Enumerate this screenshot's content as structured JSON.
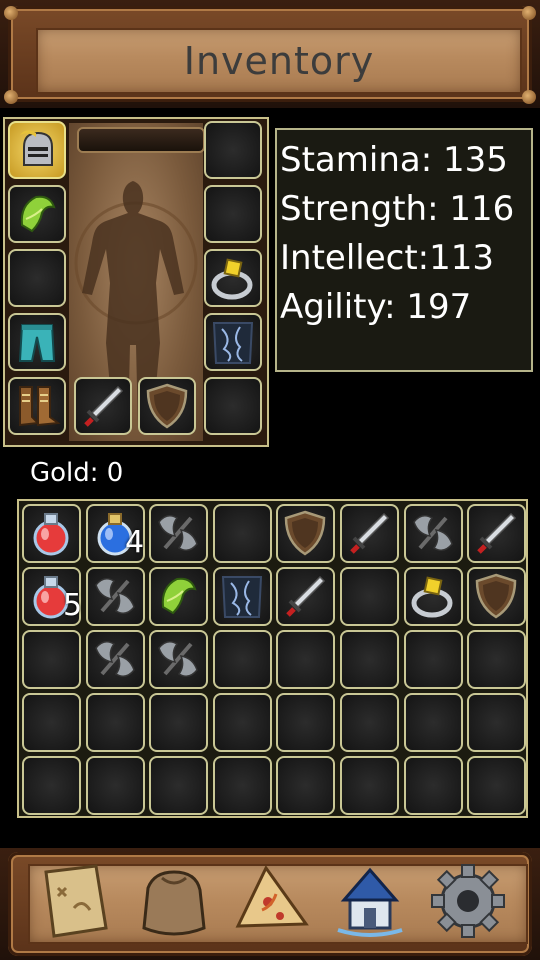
{
  "header": {
    "title": "Inventory"
  },
  "equipment": {
    "slots": [
      {
        "icon": "helmet-icon",
        "item": true
      },
      {
        "icon": "",
        "item": false
      },
      {
        "icon": "shoulder-pad-icon",
        "item": true
      },
      {
        "icon": "",
        "item": false
      },
      {
        "icon": "",
        "item": false
      },
      {
        "icon": "ring-icon",
        "item": true
      },
      {
        "icon": "pants-icon",
        "item": true
      },
      {
        "icon": "chest-armor-icon",
        "item": true
      },
      {
        "icon": "boots-icon",
        "item": true
      },
      {
        "icon": "sword-icon",
        "item": true
      },
      {
        "icon": "shield-icon",
        "item": true
      },
      {
        "icon": "",
        "item": false
      }
    ]
  },
  "stats": {
    "stamina": "Stamina: 135",
    "strength": "Strength: 116",
    "intellect": "Intellect:113",
    "agility": "Agility: 197"
  },
  "gold": {
    "label": "Gold: 0"
  },
  "bag": {
    "rows": [
      [
        "red-potion-icon",
        "blue-potion-icon",
        "axe-icon",
        "",
        "shield-icon",
        "sword-icon",
        "axe-icon",
        "sword-icon"
      ],
      [
        "red-potion-icon",
        "axe-icon",
        "shoulder-pad-icon",
        "chest-armor-icon",
        "sword-icon",
        "",
        "ring-icon",
        "shield-icon"
      ],
      [
        "",
        "axe-icon",
        "axe-icon",
        "",
        "",
        "",
        "",
        ""
      ],
      [
        "",
        "",
        "",
        "",
        "",
        "",
        "",
        ""
      ],
      [
        "",
        "",
        "",
        "",
        "",
        "",
        "",
        ""
      ]
    ],
    "counts": {
      "blue_potion": "4",
      "red_potion": "5"
    }
  },
  "nav": [
    "map-icon",
    "bag-icon",
    "pizza-icon",
    "castle-icon",
    "gear-icon"
  ],
  "colors": {
    "slot_border": "#c9c795",
    "highlight": "#f4d86a",
    "wood": "#b88a5e"
  }
}
